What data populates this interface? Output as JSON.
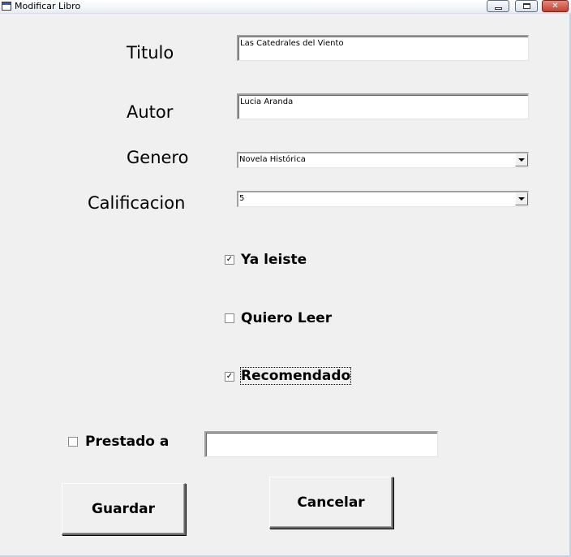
{
  "window": {
    "title": "Modificar Libro",
    "icon": "form-icon",
    "controls": {
      "minimize": "minimize-icon",
      "maximize": "maximize-icon",
      "close": "✕"
    }
  },
  "form": {
    "titulo": {
      "label": "Titulo",
      "value": "Las Catedrales del Viento"
    },
    "autor": {
      "label": "Autor",
      "value": "Lucia Aranda"
    },
    "genero": {
      "label": "Genero",
      "value": "Novela Histórica"
    },
    "calificacion": {
      "label": "Calificacion",
      "value": "5"
    },
    "ya_leiste": {
      "label": "Ya leiste",
      "checked": true,
      "mark": "✓"
    },
    "quiero_leer": {
      "label": "Quiero Leer",
      "checked": false,
      "mark": ""
    },
    "recomendado": {
      "label": "Recomendado",
      "checked": true,
      "mark": "✓"
    },
    "prestado": {
      "label": "Prestado a",
      "checked": false,
      "mark": "",
      "value": ""
    }
  },
  "buttons": {
    "guardar": "Guardar",
    "cancelar": "Cancelar"
  }
}
